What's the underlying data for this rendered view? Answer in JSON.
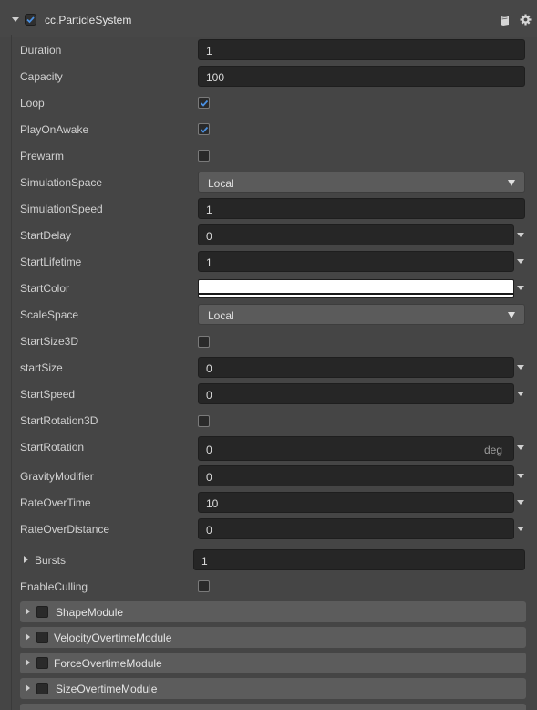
{
  "component": {
    "title": "cc.ParticleSystem",
    "enabled": true
  },
  "icons": {
    "help": "book-icon",
    "settings": "gear-icon"
  },
  "props": {
    "duration": {
      "label": "Duration",
      "value": "1"
    },
    "capacity": {
      "label": "Capacity",
      "value": "100"
    },
    "loop": {
      "label": "Loop",
      "checked": true
    },
    "play_on_awake": {
      "label": "PlayOnAwake",
      "checked": true
    },
    "prewarm": {
      "label": "Prewarm",
      "checked": false
    },
    "simulation_space": {
      "label": "SimulationSpace",
      "value": "Local"
    },
    "simulation_speed": {
      "label": "SimulationSpeed",
      "value": "1"
    },
    "start_delay": {
      "label": "StartDelay",
      "value": "0"
    },
    "start_lifetime": {
      "label": "StartLifetime",
      "value": "1"
    },
    "start_color": {
      "label": "StartColor",
      "color": "#ffffff"
    },
    "scale_space": {
      "label": "ScaleSpace",
      "value": "Local"
    },
    "start_size_3d": {
      "label": "StartSize3D",
      "checked": false
    },
    "start_size": {
      "label": "startSize",
      "value": "0"
    },
    "start_speed": {
      "label": "StartSpeed",
      "value": "0"
    },
    "start_rotation_3d": {
      "label": "StartRotation3D",
      "checked": false
    },
    "start_rotation": {
      "label": "StartRotation",
      "value": "0",
      "unit": "deg"
    },
    "gravity_modifier": {
      "label": "GravityModifier",
      "value": "0"
    },
    "rate_over_time": {
      "label": "RateOverTime",
      "value": "10"
    },
    "rate_over_distance": {
      "label": "RateOverDistance",
      "value": "0"
    },
    "bursts": {
      "label": "Bursts",
      "value": "1"
    },
    "enable_culling": {
      "label": "EnableCulling",
      "checked": false
    }
  },
  "modules": [
    {
      "label": "ShapeModule",
      "enabled": false
    },
    {
      "label": "VelocityOvertimeModule",
      "enabled": false
    },
    {
      "label": "ForceOvertimeModule",
      "enabled": false
    },
    {
      "label": "SizeOvertimeModule",
      "enabled": false
    }
  ],
  "colors": {
    "check_accent": "#4a90e2",
    "panel_bg": "#454545",
    "field_bg": "#262626"
  }
}
